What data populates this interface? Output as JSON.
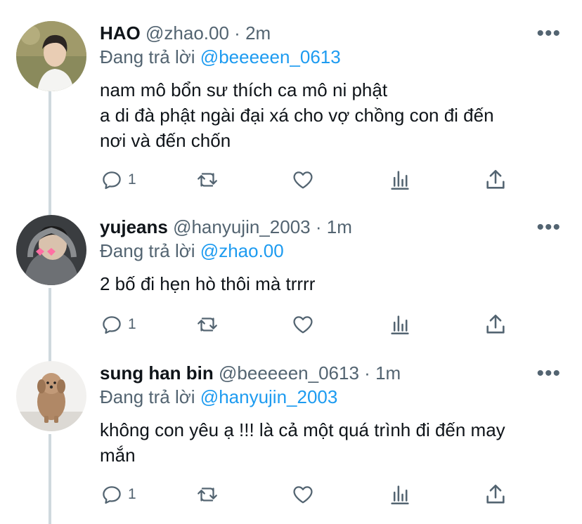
{
  "tweets": [
    {
      "display_name": "HAO",
      "handle": "@zhao.00",
      "time": "2m",
      "replying_prefix": "Đang trả lời",
      "replying_to": "@beeeeen_0613",
      "lines": [
        "nam mô bổn sư thích ca mô ni phật",
        "a di đà phật ngài đại xá cho vợ chồng con đi đến",
        "nơi và đến chốn"
      ],
      "reply_count": "1"
    },
    {
      "display_name": "yujeans",
      "handle": "@hanyujin_2003",
      "time": "1m",
      "replying_prefix": "Đang trả lời",
      "replying_to": "@zhao.00",
      "lines": [
        "2 bố đi hẹn hò thôi mà trrrr"
      ],
      "reply_count": "1"
    },
    {
      "display_name": "sung han bin",
      "handle": "@beeeeen_0613",
      "time": "1m",
      "replying_prefix": "Đang trả lời",
      "replying_to": "@hanyujin_2003",
      "lines": [
        "không con yêu ạ !!! là cả một quá trình đi đến may",
        "mắn"
      ],
      "reply_count": "1"
    }
  ],
  "separator": "·",
  "more_glyph": "•••",
  "icons": [
    "reply-icon",
    "retweet-icon",
    "like-icon",
    "analytics-icon",
    "share-icon",
    "more-icon"
  ],
  "colors": {
    "link": "#1d9bf0",
    "secondary": "#536471",
    "text": "#0f1419",
    "thread_line": "#cfd9de"
  }
}
